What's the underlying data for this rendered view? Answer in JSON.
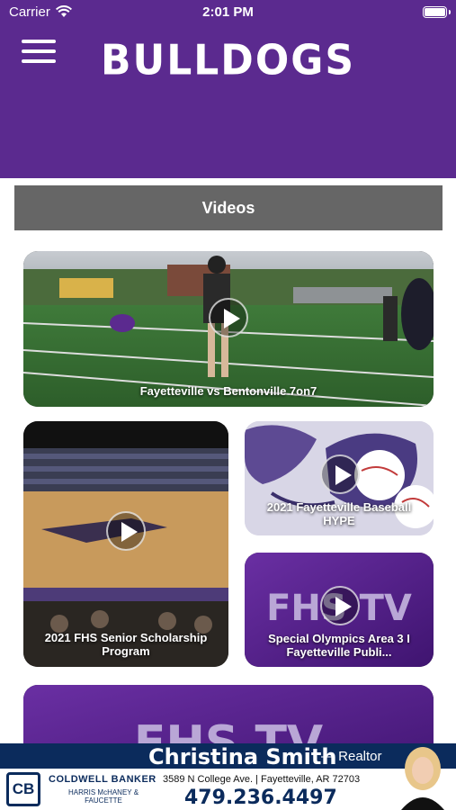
{
  "status_bar": {
    "carrier": "Carrier",
    "time": "2:01 PM"
  },
  "header": {
    "title": "BULLDOGS",
    "background": "#5b2a8f"
  },
  "section": {
    "title": "Videos"
  },
  "videos": [
    {
      "caption": "Fayetteville vs Bentonville 7on7",
      "thumb": "football-field"
    },
    {
      "caption": "2021 FHS Senior Scholarship Program",
      "thumb": "gym-floor"
    },
    {
      "caption": "2021 Fayetteville Baseball HYPE",
      "thumb": "bulldog-mascot"
    },
    {
      "caption": "Special Olympics Area 3 I Fayetteville Publi...",
      "thumb": "fhs-tv-logo"
    }
  ],
  "partial_video": {
    "thumb": "fhs-tv-logo"
  },
  "ad": {
    "name": "Christina Smith",
    "role": "— Realtor",
    "logo": "CB",
    "brand": "COLDWELL BANKER",
    "brand_sub": "HARRIS McHANEY & FAUCETTE",
    "address": "3589 N College Ave. | Fayetteville, AR 72703",
    "phone": "479.236.4497"
  }
}
